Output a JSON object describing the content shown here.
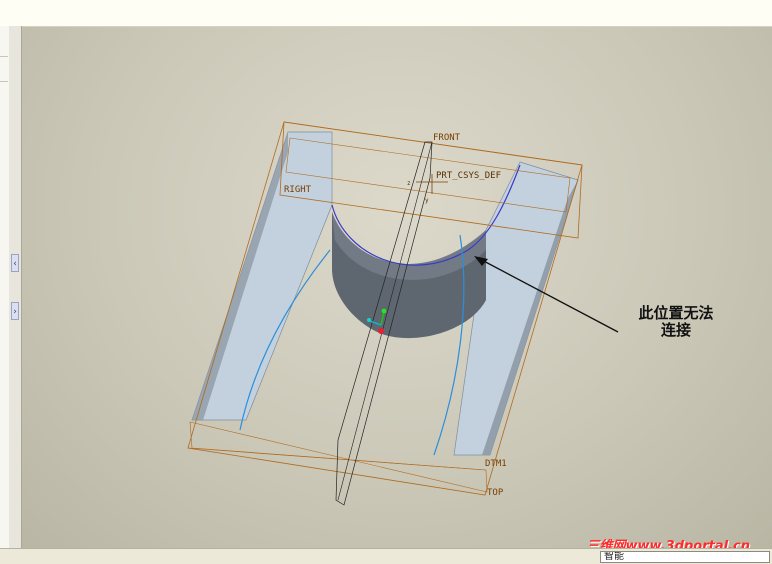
{
  "window": {
    "status_text": "智能"
  },
  "model_view": {
    "datum_planes": {
      "front": "FRONT",
      "right": "RIGHT",
      "top": "TOP",
      "dtm1": "DTM1"
    },
    "csys_label": "PRT_CSYS_DEF",
    "csys_axis_labels": {
      "z": "z",
      "y": "y"
    },
    "surface_color": "#b9cad8",
    "cut_surface_color": "#5b636d",
    "curve_color": "#2b8fdd",
    "datum_color": "#b06a1e"
  },
  "annotation": {
    "line1": "此位置无法",
    "line2": "连接"
  },
  "watermark": {
    "brand": "三维网",
    "url": "www.3dportal.cn"
  }
}
